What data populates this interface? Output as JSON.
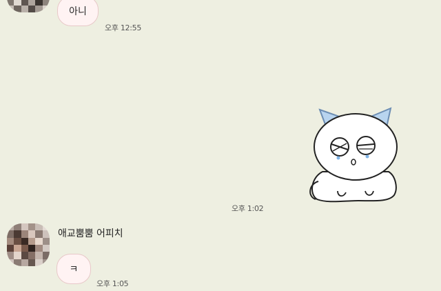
{
  "messages": {
    "first": {
      "text": "아니",
      "time": "오후 12:55"
    },
    "sticker": {
      "name": "crying-cat-sticker",
      "time": "오후 1:02"
    },
    "second": {
      "sender": "애교뿜뿜 어피치",
      "text": "ㅋ",
      "time": "오후 1:05"
    }
  },
  "colors": {
    "background": "#eeefe1",
    "bubble_fill": "#fff3f3",
    "bubble_border": "#e7c8c8",
    "cat_ears": "#b8d4ef"
  }
}
